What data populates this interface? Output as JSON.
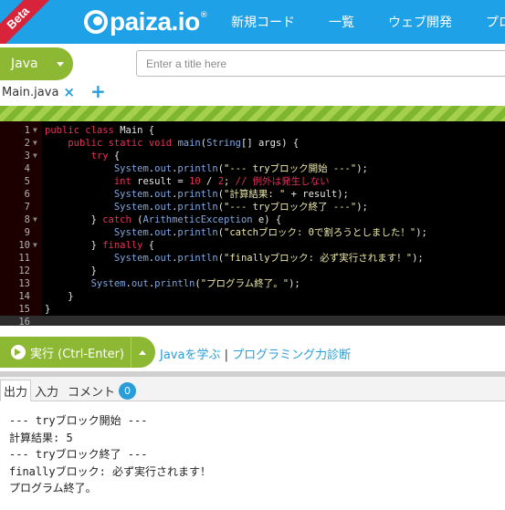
{
  "header": {
    "beta": "Beta",
    "logo": "paiza.io",
    "logo_reg": "®",
    "nav": [
      "新規コード",
      "一覧",
      "ウェブ開発",
      "プログ"
    ]
  },
  "toolbar": {
    "language": "Java",
    "title_placeholder": "Enter a title here",
    "title_value": ""
  },
  "file_tab": {
    "name": "Main.java",
    "close_icon": "×",
    "add_icon": "+"
  },
  "editor": {
    "lines": [
      {
        "n": "1",
        "fold": true,
        "tokens": [
          [
            "kw",
            "public "
          ],
          [
            "kw",
            "class "
          ],
          [
            "pl",
            "Main {"
          ]
        ]
      },
      {
        "n": "2",
        "fold": true,
        "tokens": [
          [
            "pl",
            "    "
          ],
          [
            "kw",
            "public "
          ],
          [
            "kw",
            "static "
          ],
          [
            "ty",
            "void "
          ],
          [
            "fn",
            "main"
          ],
          [
            "pl",
            "("
          ],
          [
            "cls",
            "String"
          ],
          [
            "pl",
            "[] args) {"
          ]
        ]
      },
      {
        "n": "3",
        "fold": true,
        "tokens": [
          [
            "pl",
            "        "
          ],
          [
            "kw",
            "try"
          ],
          [
            "pl",
            " {"
          ]
        ]
      },
      {
        "n": "4",
        "fold": false,
        "tokens": [
          [
            "pl",
            "            "
          ],
          [
            "cls",
            "System"
          ],
          [
            "pl",
            "."
          ],
          [
            "cls",
            "out"
          ],
          [
            "pl",
            "."
          ],
          [
            "fn",
            "println"
          ],
          [
            "pl",
            "("
          ],
          [
            "str",
            "\"--- tryブロック開始 ---\""
          ],
          [
            "pl",
            ");"
          ]
        ]
      },
      {
        "n": "5",
        "fold": false,
        "tokens": [
          [
            "pl",
            "            "
          ],
          [
            "ty",
            "int "
          ],
          [
            "pl",
            "result = "
          ],
          [
            "num",
            "10"
          ],
          [
            "pl",
            " / "
          ],
          [
            "num",
            "2"
          ],
          [
            "pl",
            "; "
          ],
          [
            "cm",
            "// 例外は発生しない"
          ]
        ]
      },
      {
        "n": "6",
        "fold": false,
        "tokens": [
          [
            "pl",
            "            "
          ],
          [
            "cls",
            "System"
          ],
          [
            "pl",
            "."
          ],
          [
            "cls",
            "out"
          ],
          [
            "pl",
            "."
          ],
          [
            "fn",
            "println"
          ],
          [
            "pl",
            "("
          ],
          [
            "str",
            "\"計算結果: \""
          ],
          [
            "pl",
            " + result);"
          ]
        ]
      },
      {
        "n": "7",
        "fold": false,
        "tokens": [
          [
            "pl",
            "            "
          ],
          [
            "cls",
            "System"
          ],
          [
            "pl",
            "."
          ],
          [
            "cls",
            "out"
          ],
          [
            "pl",
            "."
          ],
          [
            "fn",
            "println"
          ],
          [
            "pl",
            "("
          ],
          [
            "str",
            "\"--- tryブロック終了 ---\""
          ],
          [
            "pl",
            ");"
          ]
        ]
      },
      {
        "n": "8",
        "fold": true,
        "tokens": [
          [
            "pl",
            "        } "
          ],
          [
            "kw",
            "catch"
          ],
          [
            "pl",
            " ("
          ],
          [
            "cls",
            "ArithmeticException"
          ],
          [
            "pl",
            " e) {"
          ]
        ]
      },
      {
        "n": "9",
        "fold": false,
        "tokens": [
          [
            "pl",
            "            "
          ],
          [
            "cls",
            "System"
          ],
          [
            "pl",
            "."
          ],
          [
            "cls",
            "out"
          ],
          [
            "pl",
            "."
          ],
          [
            "fn",
            "println"
          ],
          [
            "pl",
            "("
          ],
          [
            "str",
            "\"catchブロック: 0で割ろうとしました！\""
          ],
          [
            "pl",
            ");"
          ]
        ]
      },
      {
        "n": "10",
        "fold": true,
        "tokens": [
          [
            "pl",
            "        } "
          ],
          [
            "kw",
            "finally"
          ],
          [
            "pl",
            " {"
          ]
        ]
      },
      {
        "n": "11",
        "fold": false,
        "tokens": [
          [
            "pl",
            "            "
          ],
          [
            "cls",
            "System"
          ],
          [
            "pl",
            "."
          ],
          [
            "cls",
            "out"
          ],
          [
            "pl",
            "."
          ],
          [
            "fn",
            "println"
          ],
          [
            "pl",
            "("
          ],
          [
            "str",
            "\"finallyブロック: 必ず実行されます！\""
          ],
          [
            "pl",
            ");"
          ]
        ]
      },
      {
        "n": "12",
        "fold": false,
        "tokens": [
          [
            "pl",
            "        }"
          ]
        ]
      },
      {
        "n": "13",
        "fold": false,
        "tokens": [
          [
            "pl",
            "        "
          ],
          [
            "cls",
            "System"
          ],
          [
            "pl",
            "."
          ],
          [
            "cls",
            "out"
          ],
          [
            "pl",
            "."
          ],
          [
            "fn",
            "println"
          ],
          [
            "pl",
            "("
          ],
          [
            "str",
            "\"プログラム終了。\""
          ],
          [
            "pl",
            ");"
          ]
        ]
      },
      {
        "n": "14",
        "fold": false,
        "tokens": [
          [
            "pl",
            "    }"
          ]
        ]
      },
      {
        "n": "15",
        "fold": false,
        "tokens": [
          [
            "pl",
            "}"
          ]
        ]
      },
      {
        "n": "16",
        "fold": false,
        "tokens": []
      }
    ],
    "active_line": 15
  },
  "runbar": {
    "run_label": "実行 (Ctrl-Enter)",
    "link1": "Javaを学ぶ",
    "separator": " | ",
    "link2": "プログラミング力診断"
  },
  "output_tabs": {
    "output": "出力",
    "input": "入力",
    "comment": "コメント",
    "comment_count": "0"
  },
  "output": {
    "lines": [
      "--- tryブロック開始 ---",
      "計算結果: 5",
      "--- tryブロック終了 ---",
      "finallyブロック: 必ず実行されます！",
      "プログラム終了。"
    ]
  },
  "colors": {
    "header_blue": "#1ea1e6",
    "button_green": "#8cb833",
    "beta_red": "#d8243b",
    "link_blue": "#2a9dd8"
  }
}
